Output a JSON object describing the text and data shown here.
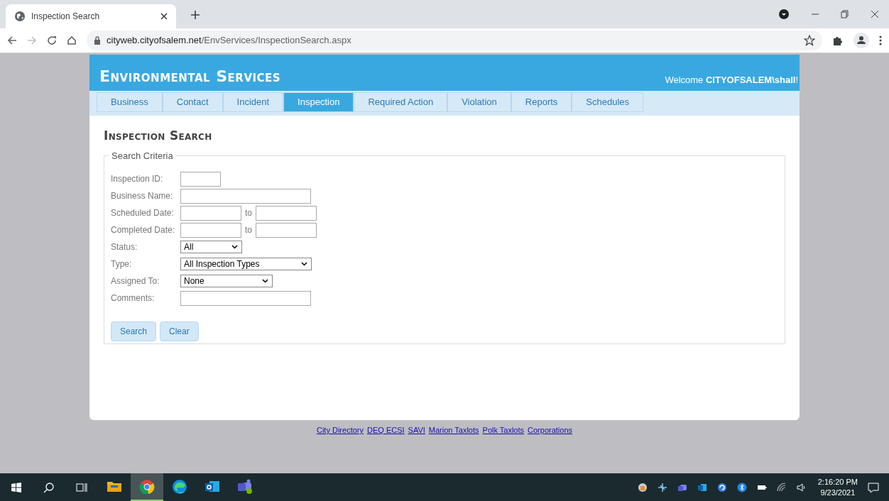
{
  "browser": {
    "tab_title": "Inspection Search",
    "url_host": "cityweb.cityofsalem.net",
    "url_path": "/EnvServices/InspectionSearch.aspx"
  },
  "header": {
    "title": "Environmental Services",
    "welcome": "Welcome **CITYOFSALEM\\shall**!"
  },
  "nav": [
    {
      "label": "Business",
      "selected": false
    },
    {
      "label": "Contact",
      "selected": false
    },
    {
      "label": "Incident",
      "selected": false
    },
    {
      "label": "Inspection",
      "selected": true
    },
    {
      "label": "Required Action",
      "selected": false
    },
    {
      "label": "Violation",
      "selected": false
    },
    {
      "label": "Reports",
      "selected": false
    },
    {
      "label": "Schedules",
      "selected": false
    }
  ],
  "heading": "Inspection Search",
  "search_criteria": {
    "legend": "Search Criteria",
    "fields": [
      {
        "kind": "text",
        "label": "Inspection ID:"
      },
      {
        "kind": "text",
        "label": "Business Name:"
      },
      {
        "kind": "range",
        "label": "Scheduled Date:",
        "separator": "to"
      },
      {
        "kind": "range",
        "label": "Completed Date:",
        "separator": "to"
      },
      {
        "kind": "select",
        "label": "Status:",
        "value": "All"
      },
      {
        "kind": "select",
        "label": "Type:",
        "value": "All Inspection Types"
      },
      {
        "kind": "select",
        "label": "Assigned To:",
        "value": "None"
      },
      {
        "kind": "text",
        "label": "Comments:"
      }
    ],
    "buttons": [
      "Search",
      "Clear"
    ]
  },
  "footer_links": [
    "City Directory",
    "DEQ ECSI",
    "SAVI",
    "Marion Taxlots",
    "Polk Taxlots",
    "Corporations"
  ],
  "taskbar": {
    "apps": [
      {
        "kind": "folder",
        "selected": false
      },
      {
        "kind": "chrome",
        "selected": true
      },
      {
        "kind": "edge",
        "selected": false
      },
      {
        "kind": "mail",
        "selected": false
      },
      {
        "kind": "chat",
        "selected": false
      }
    ],
    "time": "2:16:20 PM",
    "date": "9/23/2021"
  }
}
